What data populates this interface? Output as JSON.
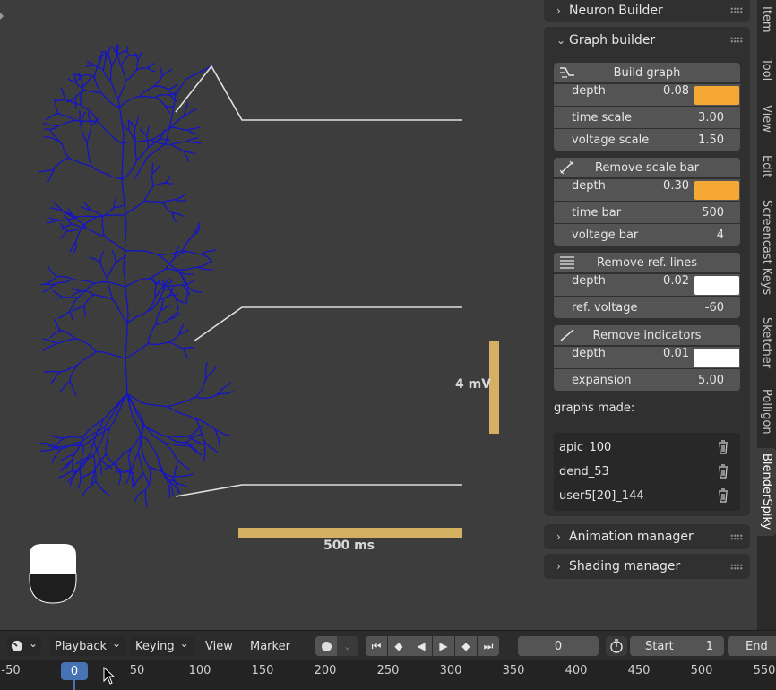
{
  "viewport": {
    "scale_label_voltage": "4 mV",
    "scale_label_time": "500 ms",
    "colors": {
      "neuron": "#1414c8",
      "trace": "#e0e0e0",
      "scale_bar": "#d4b060",
      "background": "#3d3d3d"
    }
  },
  "sidebar": {
    "panels": {
      "neuron_builder": "Neuron Builder",
      "graph_builder": "Graph builder",
      "animation_manager": "Animation manager",
      "shading_manager": "Shading manager"
    },
    "build_graph": {
      "button": "Build graph",
      "depth_label": "depth",
      "depth_value": "0.08",
      "depth_color": "#f5a833",
      "time_scale_label": "time scale",
      "time_scale_value": "3.00",
      "voltage_scale_label": "voltage scale",
      "voltage_scale_value": "1.50"
    },
    "scale_bar": {
      "button": "Remove scale bar",
      "depth_label": "depth",
      "depth_value": "0.30",
      "depth_color": "#f5a833",
      "time_bar_label": "time bar",
      "time_bar_value": "500",
      "voltage_bar_label": "voltage bar",
      "voltage_bar_value": "4"
    },
    "ref_lines": {
      "button": "Remove ref. lines",
      "depth_label": "depth",
      "depth_value": "0.02",
      "depth_color": "#ffffff",
      "ref_voltage_label": "ref. voltage",
      "ref_voltage_value": "-60"
    },
    "indicators": {
      "button": "Remove indicators",
      "depth_label": "depth",
      "depth_value": "0.01",
      "depth_color": "#ffffff",
      "expansion_label": "expansion",
      "expansion_value": "5.00"
    },
    "graphs_made_label": "graphs made:",
    "graphs": [
      "apic_100",
      "dend_53",
      "user5[20]_144"
    ]
  },
  "tabs": [
    "Item",
    "Tool",
    "View",
    "Edit",
    "Screencast Keys",
    "Sketcher",
    "Polligon",
    "BlenderSpiky"
  ],
  "active_tab": "BlenderSpiky",
  "timeline": {
    "menus": {
      "playback": "Playback",
      "keying": "Keying",
      "view": "View",
      "marker": "Marker"
    },
    "current_frame": "0",
    "start_label": "Start",
    "start_value": "1",
    "end_label": "End",
    "ruler_ticks": [
      "-50",
      "0",
      "50",
      "100",
      "150",
      "200",
      "250",
      "300",
      "350",
      "400",
      "450",
      "500",
      "550"
    ],
    "ruler_current": "0"
  }
}
